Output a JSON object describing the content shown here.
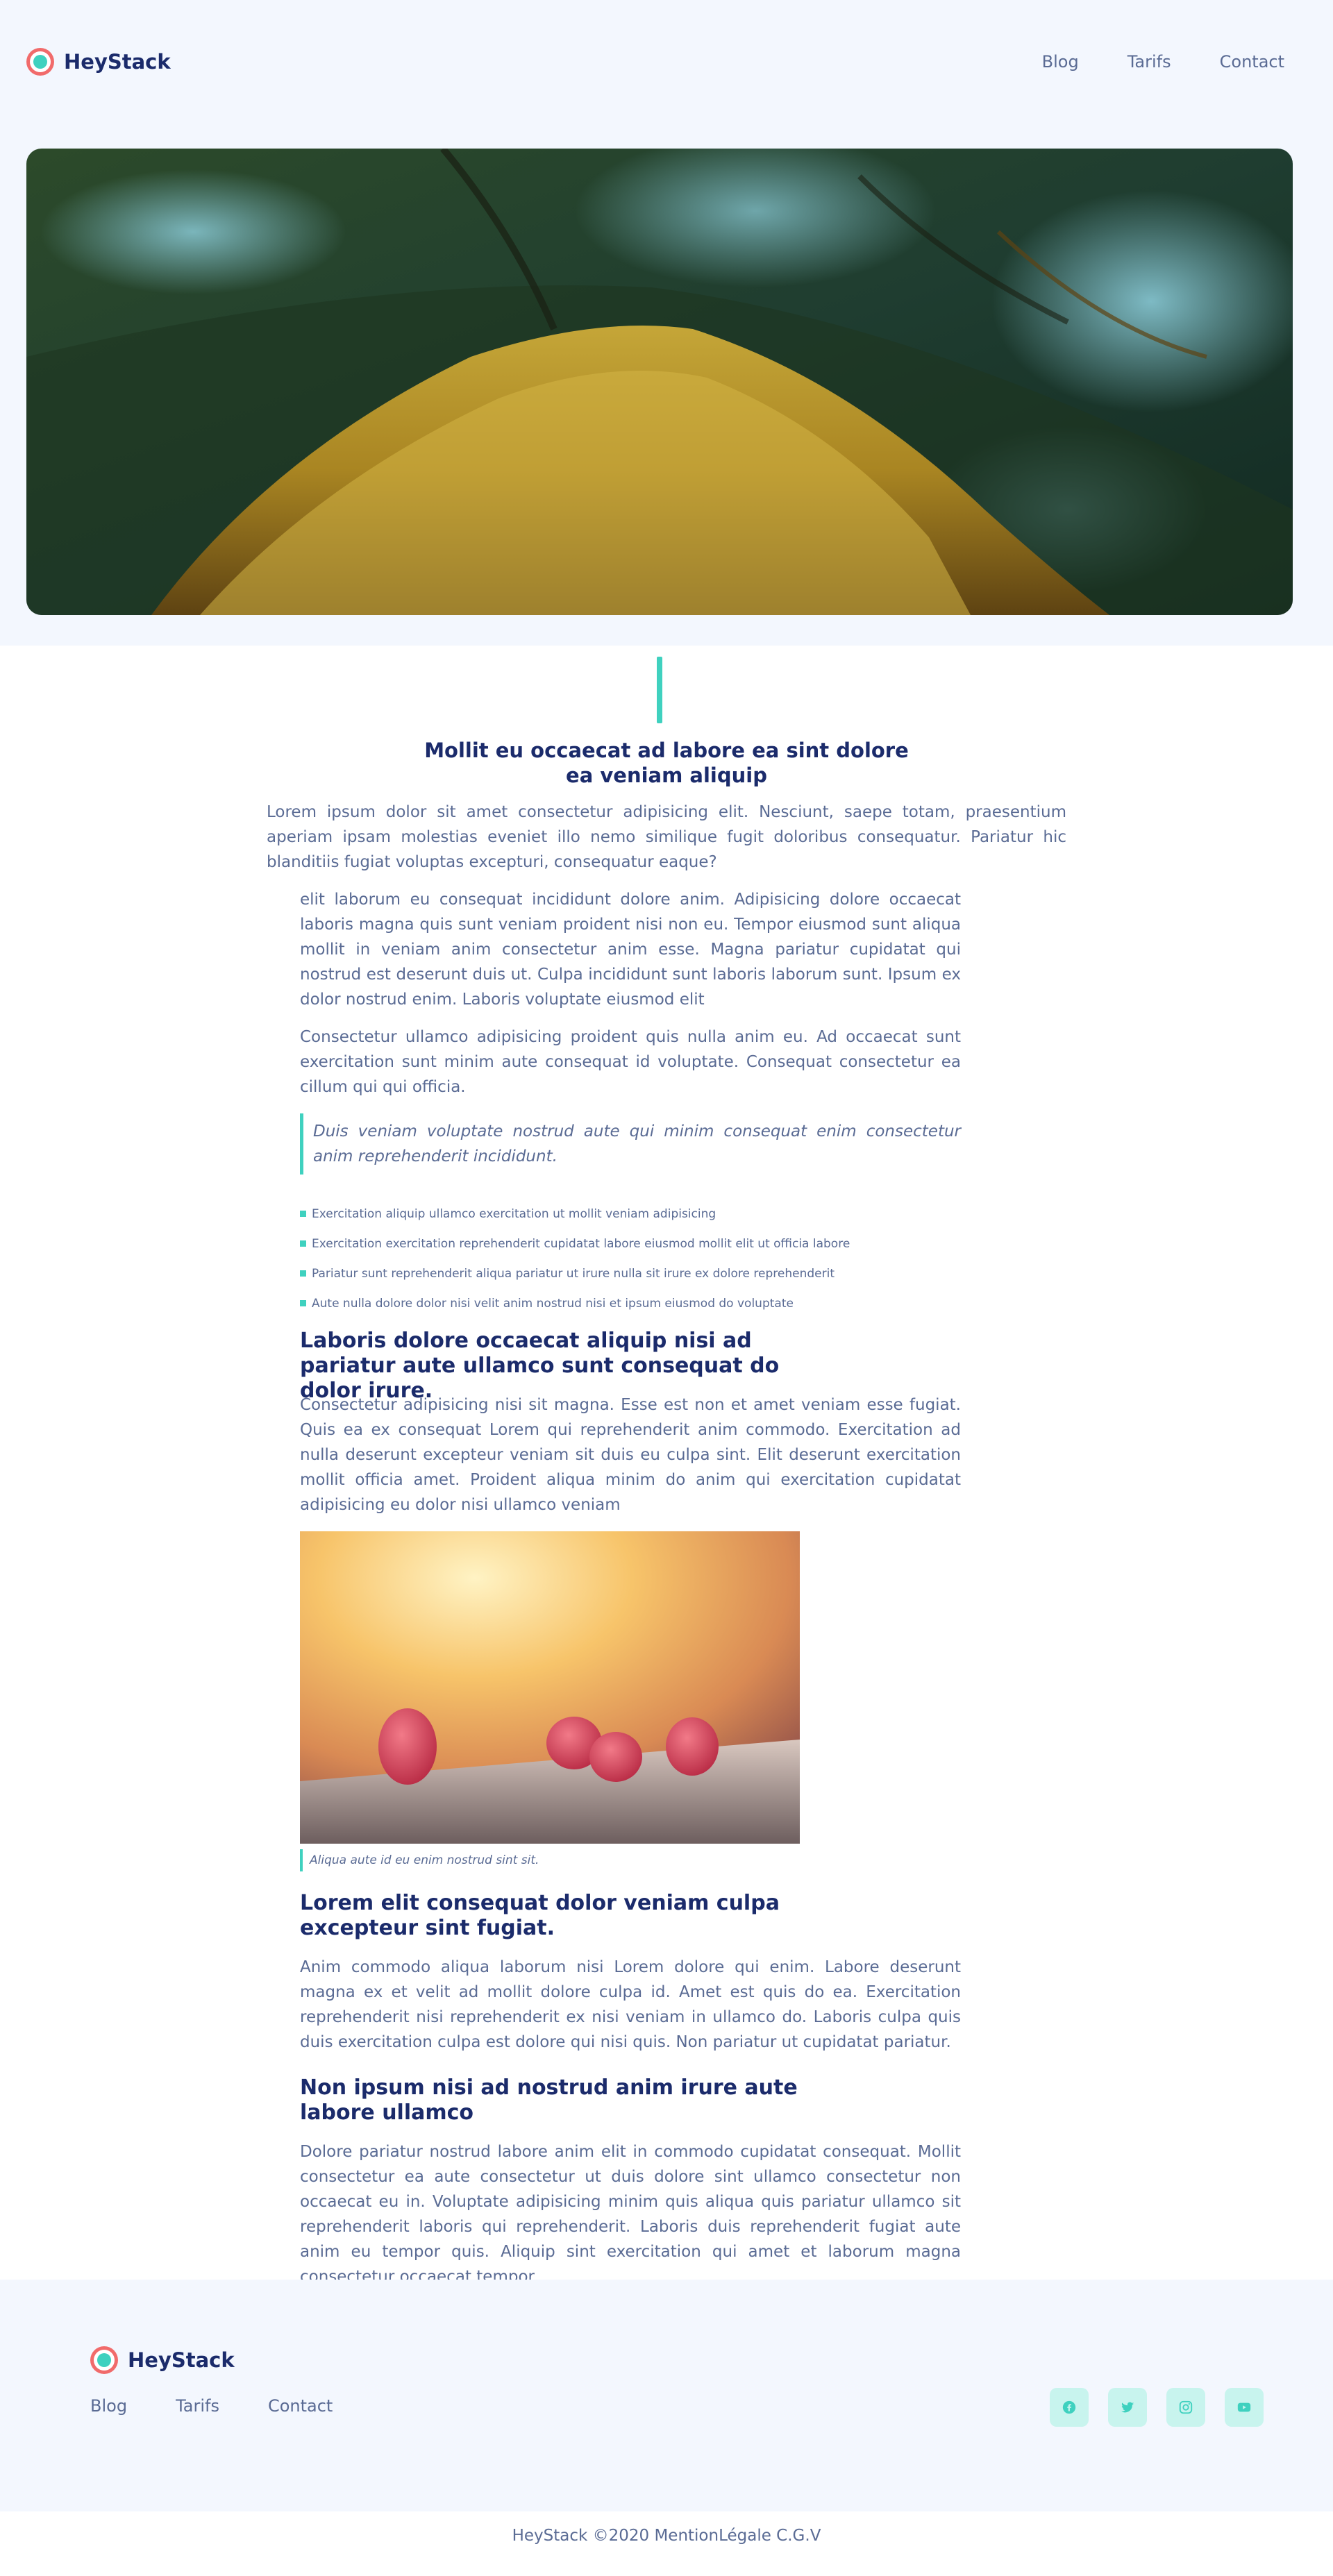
{
  "header": {
    "brand": "HeyStack",
    "nav": [
      "Blog",
      "Tarifs",
      "Contact"
    ]
  },
  "article": {
    "title": "Mollit eu occaecat ad labore ea sint dolore ea veniam aliquip",
    "intro": "Lorem ipsum dolor sit amet consectetur adipisicing elit. Nesciunt, saepe totam, praesentium aperiam ipsam molestias eveniet illo nemo similique fugit doloribus consequatur. Pariatur hic blanditiis fugiat voluptas excepturi, consequatur eaque?",
    "paragraph1": "elit laborum eu consequat incididunt dolore anim. Adipisicing dolore occaecat laboris magna quis sunt veniam proident nisi non eu. Tempor eiusmod sunt aliqua mollit in veniam anim consectetur anim esse. Magna pariatur cupidatat qui nostrud est deserunt duis ut. Culpa incididunt sunt laboris laborum sunt. Ipsum ex dolor nostrud enim. Laboris voluptate eiusmod elit",
    "paragraph2": "Consectetur ullamco adipisicing proident quis nulla anim eu. Ad occaecat sunt exercitation sunt minim aute consequat id voluptate. Consequat consectetur ea cillum qui qui officia.",
    "quote": "Duis veniam voluptate nostrud aute qui minim consequat enim consectetur anim reprehenderit incididunt.",
    "list": [
      "Exercitation aliquip ullamco exercitation ut mollit veniam adipisicing",
      "Exercitation exercitation reprehenderit cupidatat labore eiusmod mollit elit ut officia labore",
      "Pariatur sunt reprehenderit aliqua pariatur ut irure nulla sit irure ex dolore reprehenderit",
      "Aute nulla dolore dolor nisi velit anim nostrud nisi et ipsum eiusmod do voluptate"
    ],
    "heading2": "Laboris dolore occaecat aliquip nisi ad pariatur aute ullamco sunt consequat do dolor irure.",
    "paragraph3": "Consectetur adipisicing nisi sit magna. Esse est non et amet veniam esse fugiat. Quis ea ex consequat Lorem qui reprehenderit anim commodo. Exercitation ad nulla deserunt excepteur veniam sit duis eu culpa sint. Elit deserunt exercitation mollit officia amet. Proident aliqua minim do anim qui exercitation cupidatat adipisicing eu dolor nisi ullamco veniam",
    "caption": "Aliqua aute id eu enim nostrud sint sit.",
    "heading3": "Lorem elit consequat dolor veniam culpa excepteur sint fugiat.",
    "paragraph4": "Anim commodo aliqua laborum nisi Lorem dolore qui enim. Labore deserunt magna ex et velit ad mollit dolore culpa id. Amet est quis do ea. Exercitation reprehenderit nisi reprehenderit ex nisi veniam in ullamco do. Laboris culpa quis duis exercitation culpa est dolore qui nisi quis. Non pariatur ut cupidatat pariatur.",
    "heading4": "Non ipsum nisi ad nostrud anim irure aute labore ullamco",
    "paragraph5": "Dolore pariatur nostrud labore anim elit in commodo cupidatat consequat. Mollit consectetur ea aute consectetur ut duis dolore sint ullamco consectetur non occaecat eu in. Voluptate adipisicing minim quis aliqua quis pariatur ullamco sit reprehenderit laboris qui reprehenderit. Laboris duis reprehenderit fugiat aute anim eu tempor quis. Aliquip sint exercitation qui amet et laborum magna consectetur occaecat tempor."
  },
  "footer": {
    "brand": "HeyStack",
    "nav": [
      "Blog",
      "Tarifs",
      "Contact"
    ],
    "socials": [
      "facebook-icon",
      "twitter-icon",
      "instagram-icon",
      "youtube-icon"
    ],
    "copyright": "HeyStack ©2020 MentionLégale C.G.V"
  },
  "colors": {
    "accent": "#3fd1bf",
    "heading": "#1b2b6b",
    "text": "#5a6b94",
    "logo": "#f16b6b",
    "band": "#f3f7fe"
  }
}
